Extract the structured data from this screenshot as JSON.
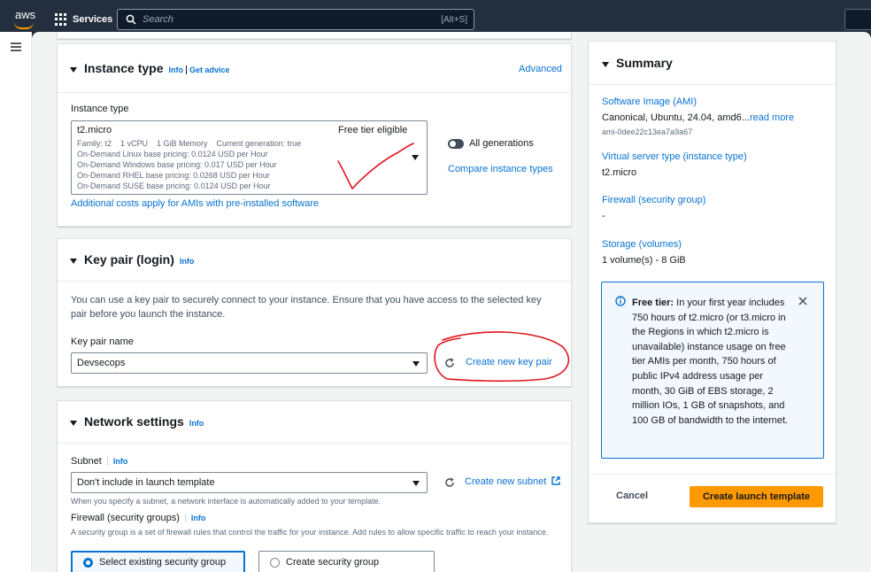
{
  "topbar": {
    "logo_text": "aws",
    "services_label": "Services",
    "search_placeholder": "Search",
    "search_shortcut": "[Alt+S]"
  },
  "instance_type": {
    "title": "Instance type",
    "info": "Info",
    "get_advice": "Get advice",
    "advanced": "Advanced",
    "field_label": "Instance type",
    "selected": "t2.micro",
    "free_tier": "Free tier eligible",
    "details_line1": "Family: t2    1 vCPU    1 GiB Memory    Current generation: true",
    "details_line2": "On-Demand Linux base pricing: 0.0124 USD per Hour",
    "details_line3": "On-Demand Windows base pricing: 0.017 USD per Hour",
    "details_line4": "On-Demand RHEL base pricing: 0.0268 USD per Hour",
    "details_line5": "On-Demand SUSE base pricing: 0.0124 USD per Hour",
    "all_generations": "All generations",
    "compare_link": "Compare instance types",
    "additional_costs_link": "Additional costs apply for AMIs with pre-installed software"
  },
  "key_pair": {
    "title": "Key pair (login)",
    "info": "Info",
    "description": "You can use a key pair to securely connect to your instance. Ensure that you have access to the selected key pair before you launch the instance.",
    "field_label": "Key pair name",
    "selected": "Devsecops",
    "create_link": "Create new key pair"
  },
  "network": {
    "title": "Network settings",
    "info": "Info",
    "subnet_label": "Subnet",
    "subnet_info": "Info",
    "subnet_selected": "Don't include in launch template",
    "create_subnet_link": "Create new subnet",
    "subnet_note": "When you specify a subnet, a network interface is automatically added to your template.",
    "firewall_label": "Firewall (security groups)",
    "firewall_info": "Info",
    "firewall_note": "A security group is a set of firewall rules that control the traffic for your instance. Add rules to allow specific traffic to reach your instance.",
    "option_existing": "Select existing security group",
    "option_create": "Create security group"
  },
  "summary": {
    "title": "Summary",
    "ami_label": "Software Image (AMI)",
    "ami_value": "Canonical, Ubuntu, 24.04, amd6...",
    "read_more": "read more",
    "ami_id": "ami-0dee22c13ea7a9a67",
    "server_type_label": "Virtual server type (instance type)",
    "server_type_value": "t2.micro",
    "firewall_label": "Firewall (security group)",
    "firewall_value": "-",
    "storage_label": "Storage (volumes)",
    "storage_value": "1 volume(s) - 8 GiB",
    "free_tier_title": "Free tier:",
    "free_tier_text": " In your first year includes 750 hours of t2.micro (or t3.micro in the Regions in which t2.micro is unavailable) instance usage on free tier AMIs per month, 750 hours of public IPv4 address usage per month, 30 GiB of EBS storage, 2 million IOs, 1 GB of snapshots, and 100 GB of bandwidth to the internet.",
    "cancel": "Cancel",
    "create_template": "Create launch template"
  },
  "colors": {
    "nav_bg": "#232f3e",
    "link": "#0972d3",
    "primary_button": "#ff9900",
    "annotation_red": "#e0141e"
  }
}
